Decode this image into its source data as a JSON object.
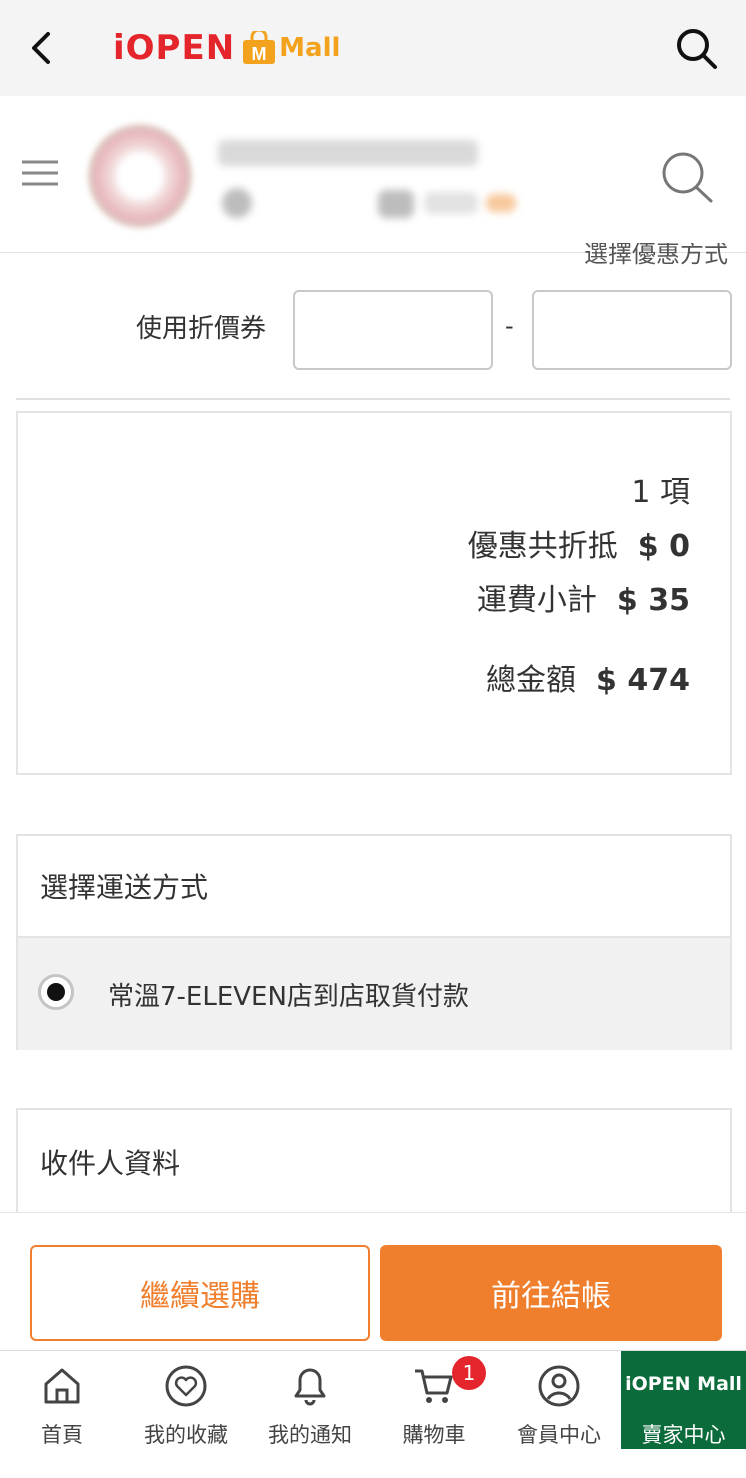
{
  "header": {
    "logo_main": "iOPEN",
    "logo_sub": "Mall",
    "brand_colors": {
      "red": "#e4252c",
      "orange": "#f3a21e"
    }
  },
  "checkout": {
    "promo_method_label": "選擇優惠方式",
    "coupon_label": "使用折價券",
    "coupon_code_1": "",
    "coupon_separator": "-",
    "coupon_code_2": ""
  },
  "summary": {
    "item_count": "1 項",
    "discount_label": "優惠共折抵",
    "discount_value": "$ 0",
    "shipping_label": "運費小計",
    "shipping_value": "$ 35",
    "total_label": "總金額",
    "total_value": "$ 474"
  },
  "shipping": {
    "title": "選擇運送方式",
    "selected_option": "常溫7-ELEVEN店到店取貨付款"
  },
  "recipient": {
    "title": "收件人資料"
  },
  "actions": {
    "continue_label": "繼續選購",
    "checkout_label": "前往結帳",
    "accent": "#f07f2d"
  },
  "tabbar": {
    "home": "首頁",
    "favorites": "我的收藏",
    "notifications": "我的通知",
    "cart": "購物車",
    "cart_badge": "1",
    "member": "會員中心",
    "seller_logo": "iOPEN Mall",
    "seller": "賣家中心",
    "seller_color": "#0b6b3a"
  }
}
